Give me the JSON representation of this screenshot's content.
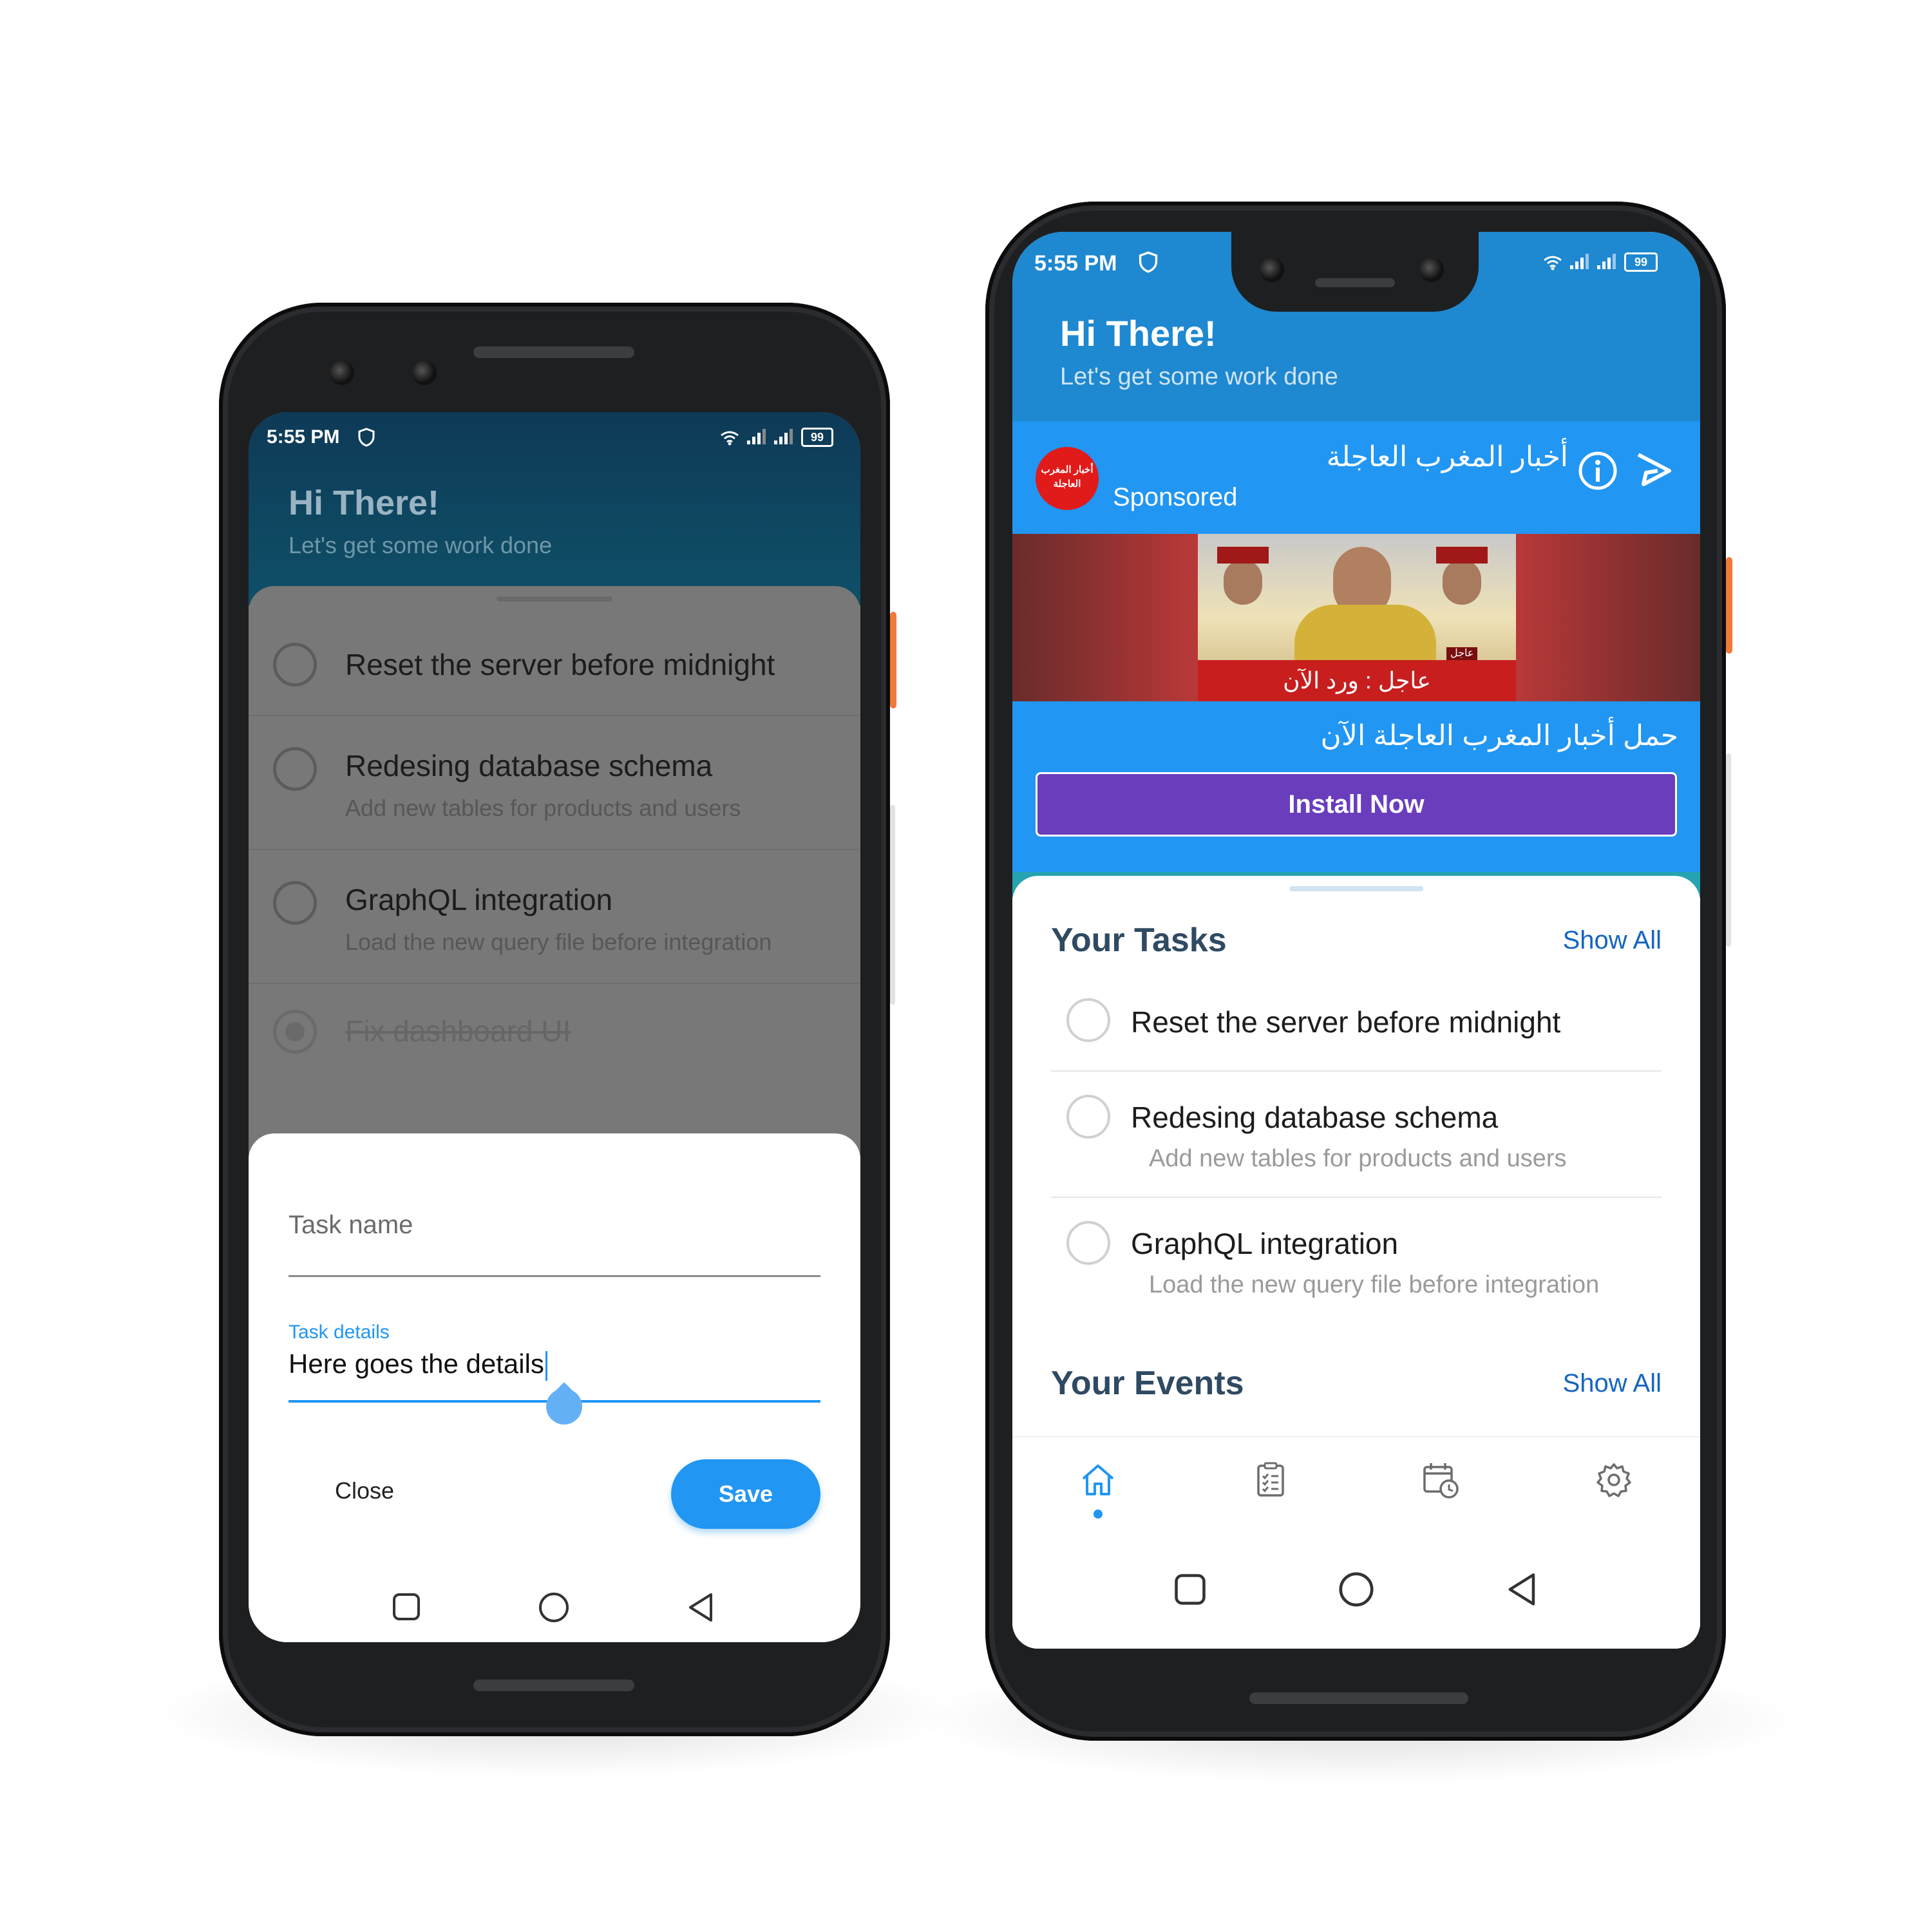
{
  "left_phone": {
    "status": {
      "time": "5:55 PM",
      "battery": "99"
    },
    "header": {
      "greeting": "Hi There!",
      "subtitle": "Let's get some work done"
    },
    "tasks": [
      {
        "title": "Reset the server before midnight",
        "details": "",
        "done": false
      },
      {
        "title": "Redesing database schema",
        "details": "Add new tables for products and users",
        "done": false
      },
      {
        "title": "GraphQL integration",
        "details": "Load the new query file before integration",
        "done": false
      },
      {
        "title": "Fix dashboard UI",
        "details": "",
        "done": true
      }
    ],
    "dialog": {
      "task_name_placeholder": "Task name",
      "task_details_label": "Task details",
      "task_details_value": "Here goes the details",
      "close_label": "Close",
      "save_label": "Save"
    }
  },
  "right_phone": {
    "status": {
      "time": "5:55 PM",
      "battery": "99"
    },
    "header": {
      "greeting": "Hi There!",
      "subtitle": "Let's get some work done"
    },
    "ad": {
      "logo_text_line1": "أخبار المغرب",
      "logo_text_line2": "العاجلة",
      "title": "أخبار المغرب العاجلة",
      "sponsored": "Sponsored",
      "image_tag": "عاجل",
      "image_caption": "عاجل : ورد الآن",
      "cta_text": "حمل أخبار المغرب العاجلة الآن",
      "install_label": "Install Now"
    },
    "tasks_section": {
      "title": "Your Tasks",
      "show_all": "Show All"
    },
    "tasks": [
      {
        "title": "Reset the server before midnight",
        "details": ""
      },
      {
        "title": "Redesing database schema",
        "details": "Add new tables for products and users"
      },
      {
        "title": "GraphQL integration",
        "details": "Load the new query file before integration"
      }
    ],
    "events_section": {
      "title": "Your Events",
      "show_all": "Show All"
    },
    "bottom_nav": [
      "home-icon",
      "tasks-icon",
      "calendar-icon",
      "settings-icon"
    ],
    "active_tab": "home-icon"
  },
  "colors": {
    "accent": "#2196f3",
    "install": "#6a3dbd",
    "header_right": "#1e88d0",
    "header_left": "#0e3a57"
  }
}
